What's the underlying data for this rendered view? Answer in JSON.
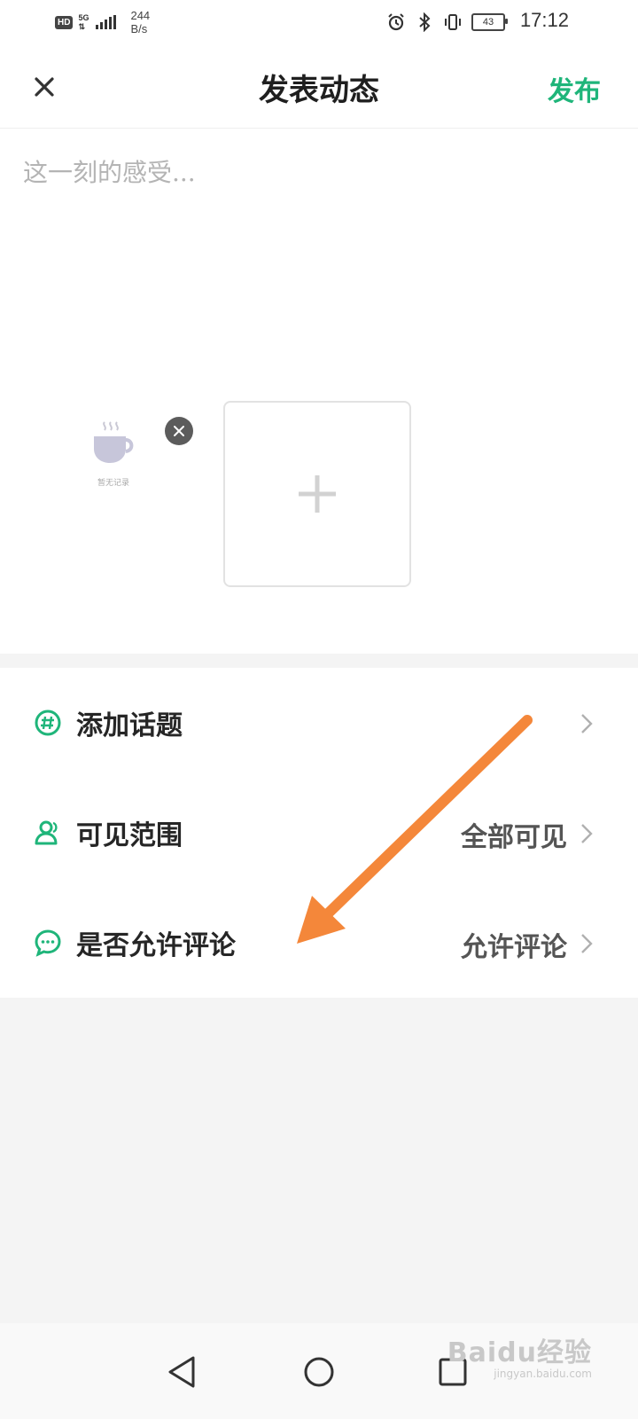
{
  "status_bar": {
    "hd": "HD",
    "network": "5G",
    "speed_value": "244",
    "speed_unit": "B/s",
    "battery": "43",
    "time": "17:12"
  },
  "header": {
    "title": "发表动态",
    "publish_label": "发布",
    "close_icon": "close-icon"
  },
  "editor": {
    "placeholder": "这一刻的感受...",
    "value": "",
    "image_caption": "暂无记录"
  },
  "settings": {
    "items": [
      {
        "icon": "topic-hash-icon",
        "label": "添加话题",
        "value": ""
      },
      {
        "icon": "user-icon",
        "label": "可见范围",
        "value": "全部可见"
      },
      {
        "icon": "comment-icon",
        "label": "是否允许评论",
        "value": "允许评论"
      }
    ]
  },
  "watermark": {
    "brand": "Baidu经验",
    "url": "jingyan.baidu.com"
  },
  "colors": {
    "accent": "#1fb57a",
    "annotation_arrow": "#f4873a",
    "page_bg": "#f4f4f4"
  }
}
